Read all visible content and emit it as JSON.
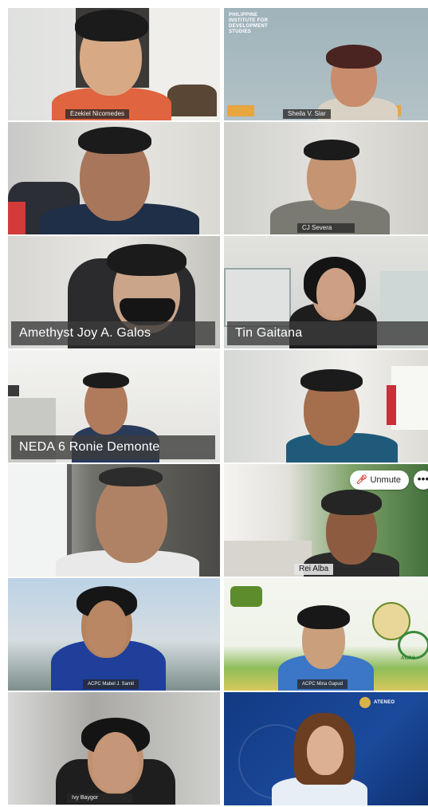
{
  "meeting": {
    "participants": [
      {
        "name": "Ezekiel Nicomedes",
        "label_style": "small"
      },
      {
        "name": "Sheila V. Siar",
        "label_style": "small",
        "org_text": "PHILIPPINE INSTITUTE FOR DEVELOPMENT STUDIES"
      },
      {
        "name": "",
        "label_style": "small"
      },
      {
        "name": "CJ Severa",
        "label_style": "small"
      },
      {
        "name": "Amethyst Joy A. Galos",
        "label_style": "big"
      },
      {
        "name": "Tin Gaitana",
        "label_style": "big"
      },
      {
        "name": "NEDA 6 Ronie Demonte",
        "label_style": "big"
      },
      {
        "name": "",
        "label_style": "none"
      },
      {
        "name": "",
        "label_style": "none"
      },
      {
        "name": "Rei Alba",
        "label_style": "small"
      },
      {
        "name": "ACPC Mabel J. Samit",
        "label_style": "small"
      },
      {
        "name": "ACPC Mina Gapud",
        "label_style": "small",
        "logo_text": "ACPC"
      },
      {
        "name": "Ivy Baygor",
        "label_style": "small"
      },
      {
        "name": "",
        "label_style": "none",
        "banner_text": "ATENEO"
      }
    ],
    "controls": {
      "unmute_label": "Unmute",
      "unmute_icon": "mic-off-icon",
      "more_label": "•••",
      "more_icon": "more-options-icon"
    }
  }
}
